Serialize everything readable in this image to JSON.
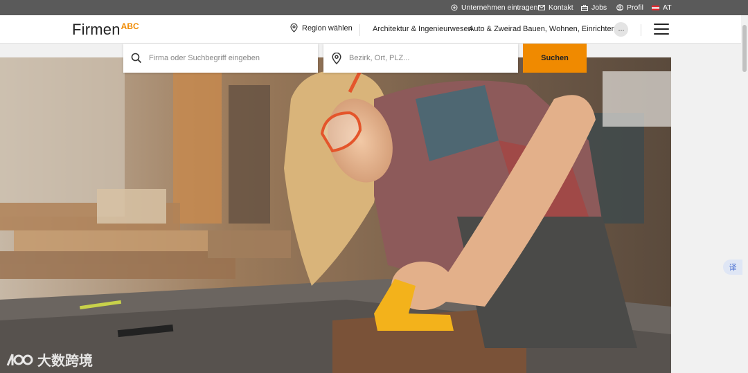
{
  "topbar": {
    "items": [
      {
        "label": "Unternehmen eintragen",
        "icon": "plus-circle-icon"
      },
      {
        "label": "Kontakt",
        "icon": "mail-icon"
      },
      {
        "label": "Jobs",
        "icon": "briefcase-icon"
      },
      {
        "label": "Profil",
        "icon": "user-icon"
      },
      {
        "label": "AT",
        "icon": "austria-flag-icon"
      }
    ]
  },
  "header": {
    "logo": {
      "main": "Firmen",
      "sup": "ABC"
    },
    "region_label": "Region wählen",
    "nav": [
      "Architektur & Ingenieurwesen",
      "Auto & Zweirad",
      "Bauen, Wohnen, Einrichten"
    ],
    "more_label": "···"
  },
  "search": {
    "query_placeholder": "Firma oder Suchbegriff eingeben",
    "location_placeholder": "Bezirk, Ort, PLZ...",
    "button_label": "Suchen"
  },
  "floating": {
    "translate_label": "译"
  },
  "watermark": {
    "text": "大数跨境"
  },
  "colors": {
    "accent": "#f08a00",
    "topbar_bg": "#5a5a5a",
    "header_bg": "#ffffff"
  }
}
